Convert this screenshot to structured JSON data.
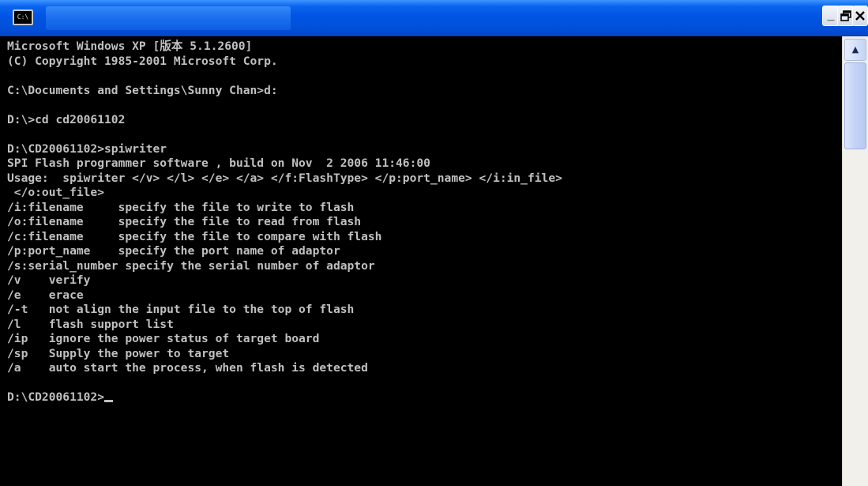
{
  "window": {
    "title": "",
    "icon": "console-window-icon",
    "icon_glyph": "C:\\",
    "buttons": {
      "minimize": "_",
      "maximize": "🗗",
      "close": "✕"
    }
  },
  "console": {
    "lines": [
      "Microsoft Windows XP [版本 5.1.2600]",
      "(C) Copyright 1985-2001 Microsoft Corp.",
      "",
      "C:\\Documents and Settings\\Sunny Chan>d:",
      "",
      "D:\\>cd cd20061102",
      "",
      "D:\\CD20061102>spiwriter",
      "SPI Flash programmer software , build on Nov  2 2006 11:46:00",
      "Usage:  spiwriter </v> </l> </e> </a> </f:FlashType> </p:port_name> </i:in_file>",
      " </o:out_file>",
      "/i:filename     specify the file to write to flash",
      "/o:filename     specify the file to read from flash",
      "/c:filename     specify the file to compare with flash",
      "/p:port_name    specify the port name of adaptor",
      "/s:serial_number specify the serial number of adaptor",
      "/v    verify",
      "/e    erace",
      "/-t   not align the input file to the top of flash",
      "/l    flash support list",
      "/ip   ignore the power status of target board",
      "/sp   Supply the power to target",
      "/a    auto start the process, when flash is detected",
      "",
      "D:\\CD20061102>"
    ]
  },
  "scrollbar": {
    "up_arrow": "▲"
  },
  "colors": {
    "titlebar": "#0054e3",
    "console_bg": "#000000",
    "console_text": "#c0c0c0"
  }
}
